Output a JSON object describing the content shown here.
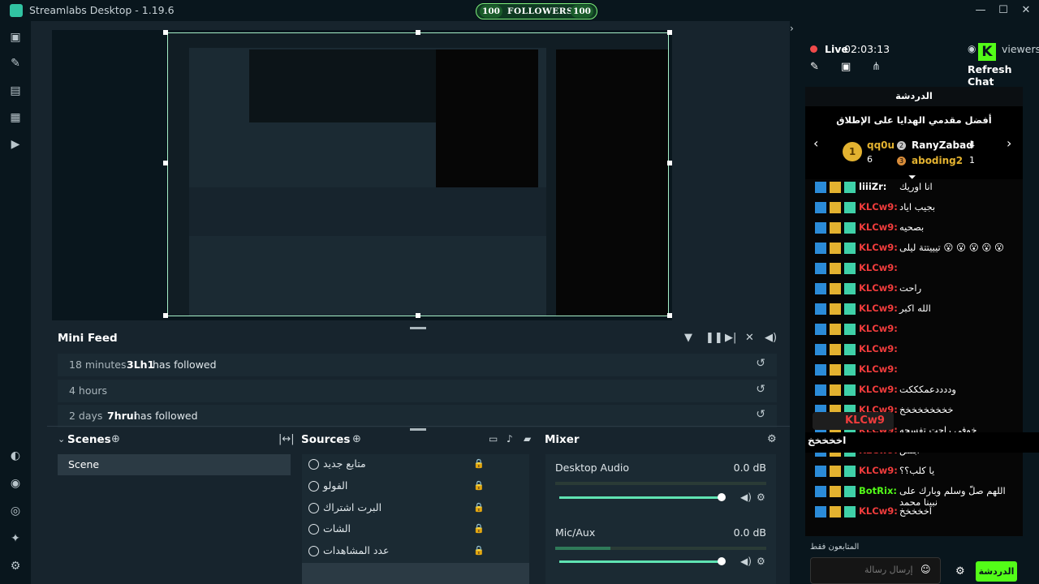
{
  "app": {
    "title": "Streamlabs Desktop - 1.19.6"
  },
  "follow_goal": {
    "left": "100",
    "label": "FOLLOWERS",
    "right": "100"
  },
  "window": {
    "minimize": "—",
    "maximize": "☐",
    "close": "✕"
  },
  "nav": {
    "items": [
      "editor-icon",
      "themes-icon",
      "store-icon",
      "layout-icon",
      "play-icon",
      "studio-icon",
      "settings-icon"
    ]
  },
  "mini_feed": {
    "title": "Mini Feed",
    "rows": [
      {
        "time": "18 minutes",
        "name": "3Lh1",
        "action": "has followed"
      },
      {
        "time": "4 hours",
        "name": "",
        "action": ""
      },
      {
        "time": "2 days",
        "name": "7hrui",
        "action": "has followed"
      }
    ]
  },
  "scenes": {
    "title": "Scenes",
    "items": [
      "Scene"
    ]
  },
  "sources": {
    "title": "Sources",
    "items": [
      "متابع جديد",
      "الفولو",
      "البرت اشتراك",
      "الشات",
      "عدد المشاهدات"
    ]
  },
  "mixer": {
    "title": "Mixer",
    "channels": [
      {
        "name": "Desktop Audio",
        "db": "0.0 dB",
        "level": 0.0
      },
      {
        "name": "Mic/Aux",
        "db": "0.0 dB",
        "level": 0.26
      }
    ]
  },
  "stream": {
    "live_label": "Live",
    "time": "02:03:13",
    "viewers_label": "viewers",
    "refresh_chat": "Refresh Chat"
  },
  "chat": {
    "header": "الدردشة",
    "leaderboard_title": "أفضل مقدمي الهدايا على الإطلاق",
    "leaders": [
      {
        "rank": "1",
        "name": "qq0u",
        "count": "6"
      },
      {
        "rank": "2",
        "name": "RanyZabad",
        "count": "4"
      },
      {
        "rank": "3",
        "name": "aboding2",
        "count": "1"
      }
    ],
    "messages": [
      {
        "user": "liiiZr",
        "text": "انا اوريك",
        "color": "#ffffff"
      },
      {
        "user": "KLCw9",
        "text": "بجيب اياد",
        "color": "#f03c3c"
      },
      {
        "user": "KLCw9",
        "text": "بصحيه",
        "color": "#f03c3c"
      },
      {
        "user": "KLCw9",
        "text": "تيييتتة ليلى 😮 😮 😮 😮 😮",
        "color": "#f03c3c"
      },
      {
        "user": "KLCw9",
        "text": "",
        "color": "#f03c3c"
      },
      {
        "user": "KLCw9",
        "text": "راحت",
        "color": "#f03c3c"
      },
      {
        "user": "KLCw9",
        "text": "الله اكبر",
        "color": "#f03c3c"
      },
      {
        "user": "KLCw9",
        "text": "",
        "color": "#f03c3c"
      },
      {
        "user": "KLCw9",
        "text": "",
        "color": "#f03c3c"
      },
      {
        "user": "KLCw9",
        "text": "",
        "color": "#f03c3c"
      },
      {
        "user": "KLCw9",
        "text": "وددددعمكككت",
        "color": "#f03c3c"
      },
      {
        "user": "KLCw9",
        "text": "خخخخخخخخخ",
        "color": "#f03c3c"
      },
      {
        "user": "KLCw9",
        "text": "خوفي راحت تفسحه",
        "color": "#f03c3c"
      },
      {
        "user": "KLCw9",
        "text": "ابلش",
        "color": "#f03c3c"
      },
      {
        "user": "KLCw9",
        "text": "يا كلب؟؟",
        "color": "#f03c3c"
      },
      {
        "user": "BotRix",
        "text": "اللهم صلّ وسلم وبارك على نبينا محمد",
        "color": "#53fc18"
      },
      {
        "user": "KLCw9",
        "text": "اخخخخخ",
        "color": "#f03c3c"
      }
    ],
    "highlight": {
      "user": "KLCw9",
      "text": "اخخخخخ"
    },
    "followers_only": "المتابعون فقط",
    "input_placeholder": "إرسال رسالة",
    "send_label": "الدردشة"
  }
}
